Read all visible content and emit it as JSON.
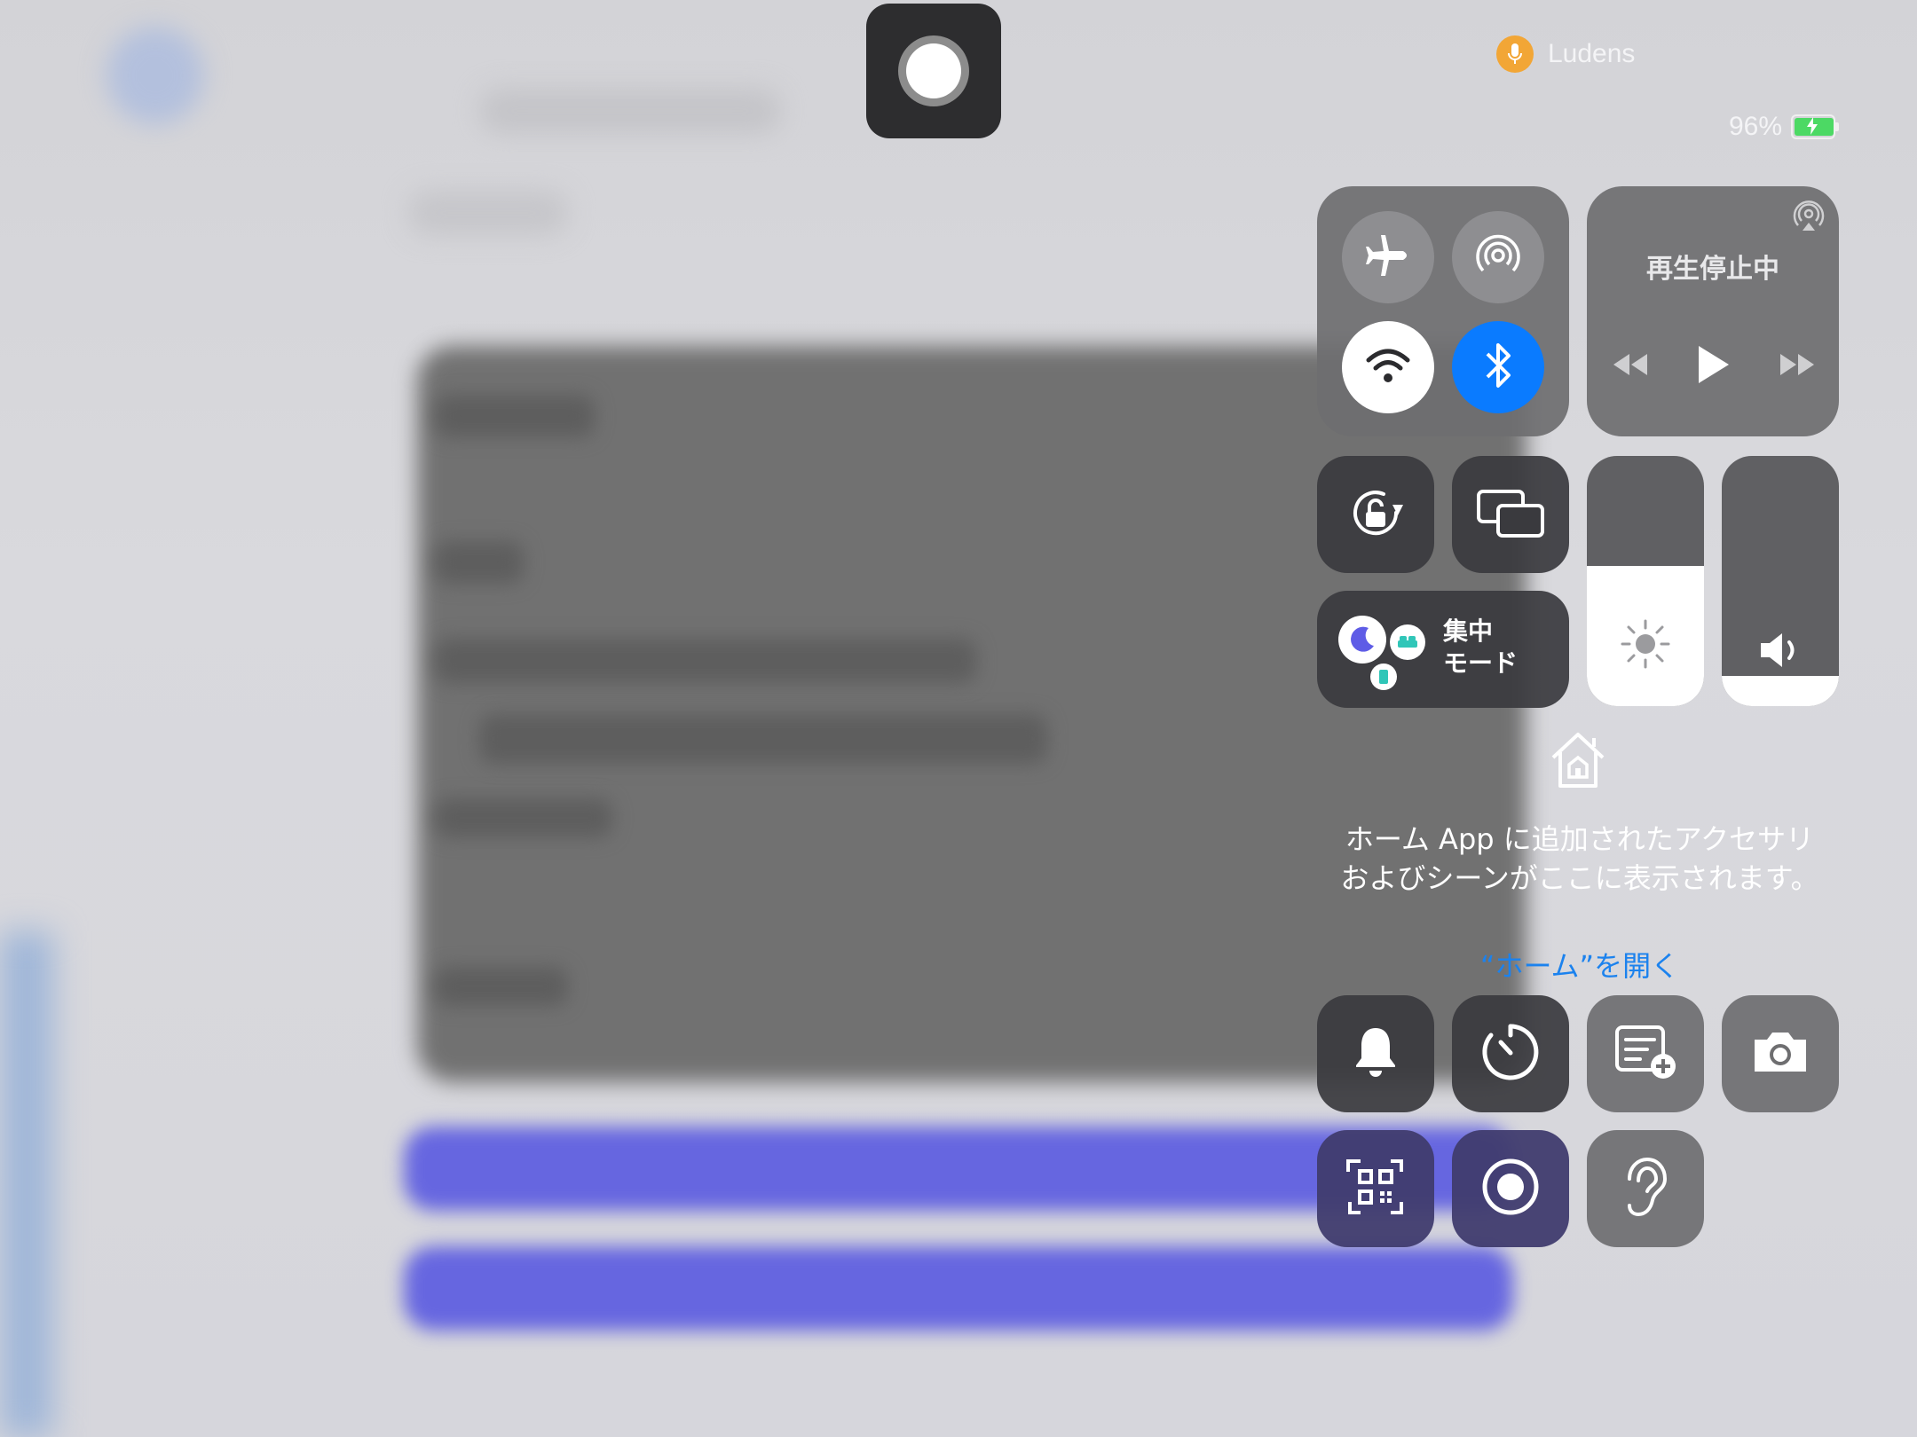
{
  "recording_indicator": {
    "icon": "screen-record-icon"
  },
  "status_bar": {
    "app_name": "Ludens",
    "mic_icon": "microphone-icon",
    "battery_percent": "96%",
    "battery_level": 0.96,
    "charging": true
  },
  "connectivity": {
    "airplane": {
      "icon": "airplane-icon",
      "on": false
    },
    "airdrop": {
      "icon": "airdrop-icon",
      "on": false
    },
    "wifi": {
      "icon": "wifi-icon",
      "on": true
    },
    "bluetooth": {
      "icon": "bluetooth-icon",
      "on": true
    }
  },
  "now_playing": {
    "status": "再生停止中",
    "airplay_icon": "airplay-icon",
    "controls": [
      "rewind-icon",
      "play-icon",
      "fast-forward-icon"
    ]
  },
  "orientation_lock": {
    "icon": "rotation-lock-icon"
  },
  "screen_mirroring": {
    "icon": "screen-mirroring-icon"
  },
  "focus": {
    "label_line1": "集中",
    "label_line2": "モード",
    "icons": [
      "moon-icon",
      "bed-icon",
      "person-icon"
    ]
  },
  "brightness": {
    "icon": "sun-icon",
    "level": 0.56
  },
  "volume": {
    "icon": "speaker-icon",
    "level": 0.12
  },
  "home": {
    "icon": "home-icon",
    "message": "ホーム App に追加されたアクセサリおよびシーンがここに表示されます。",
    "link": "“ホーム”を開く"
  },
  "shortcuts_row1": [
    {
      "icon": "bell-icon"
    },
    {
      "icon": "timer-icon"
    },
    {
      "icon": "quick-note-icon"
    },
    {
      "icon": "camera-icon"
    }
  ],
  "shortcuts_row2": [
    {
      "icon": "qr-code-scanner-icon"
    },
    {
      "icon": "screen-record-icon"
    },
    {
      "icon": "hearing-icon"
    }
  ],
  "colors": {
    "bluetooth_active": "#0a7bff",
    "link": "#1b82ee",
    "focus_moon": "#5e5ce6",
    "focus_bed": "#30c6b8",
    "mic_badge": "#f2a636",
    "battery": "#4cd964"
  }
}
